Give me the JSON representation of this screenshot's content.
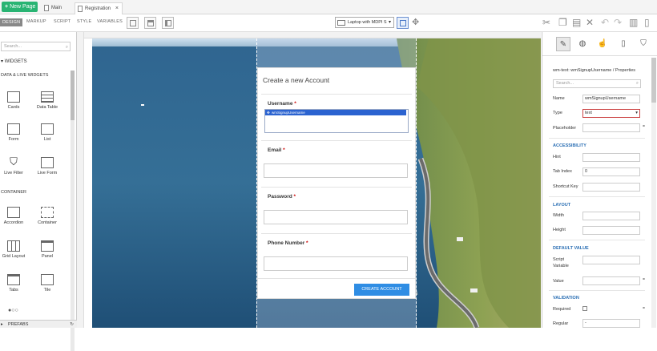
{
  "topbar": {
    "new_page_label": "New Page",
    "tabs": [
      {
        "label": "Main"
      },
      {
        "label": "Registration"
      }
    ],
    "close_glyph": "×"
  },
  "toolbar": {
    "modes": [
      "DESIGN",
      "MARKUP",
      "SCRIPT",
      "STYLE",
      "VARIABLES"
    ],
    "device": "Laptop with MDPI S",
    "icons": [
      "page-layout-icon",
      "header-layout-icon",
      "panel-layout-icon",
      "cut-icon",
      "copy-icon",
      "paste-icon",
      "delete-icon",
      "undo-icon",
      "redo-icon",
      "save-icon",
      "preview-icon"
    ]
  },
  "left": {
    "search_placeholder": "Search...",
    "widgets_header": "WIDGETS",
    "section_data": "DATA & LIVE WIDGETS",
    "section_container": "CONTAINER",
    "items": [
      {
        "label": "Cards"
      },
      {
        "label": "Data Table"
      },
      {
        "label": "Form"
      },
      {
        "label": "List"
      },
      {
        "label": "Live Filter"
      },
      {
        "label": "Live Form"
      },
      {
        "label": "Accordion"
      },
      {
        "label": "Container"
      },
      {
        "label": "Grid Layout"
      },
      {
        "label": "Panel"
      },
      {
        "label": "Tabs"
      },
      {
        "label": "Tile"
      }
    ],
    "prefabs": "PREFABS"
  },
  "form": {
    "title": "Create a new Account",
    "fields": [
      {
        "label": "Username",
        "required": "*"
      },
      {
        "label": "Email",
        "required": "*"
      },
      {
        "label": "Password",
        "required": "*"
      },
      {
        "label": "Phone Number",
        "required": "*"
      }
    ],
    "selected_widget": "wmSignupUsername",
    "submit_label": "CREATE ACCOUNT"
  },
  "properties": {
    "title": "wm-text: wmSignupUsername / Properties",
    "search_placeholder": "Search...",
    "name_label": "Name",
    "name_value": "wmSignupUsername",
    "type_label": "Type",
    "type_value": "text",
    "placeholder_label": "Placeholder",
    "accessibility": "ACCESSIBILITY",
    "hint_label": "Hint",
    "tabindex_label": "Tab Index",
    "tabindex_value": "0",
    "shortcut_label": "Shortcut Key",
    "layout": "LAYOUT",
    "width_label": "Width",
    "height_label": "Height",
    "default_value": "DEFAULT VALUE",
    "script_var_label": "Script Variable",
    "value_label": "Value",
    "validation": "VALIDATION",
    "required_label": "Required",
    "regular_label": "Regular",
    "regular_value": "-"
  },
  "colors": {
    "new_page": "#29b473",
    "button": "#2f8de4",
    "section": "#2b6fb4",
    "selection": "#2b63d0"
  }
}
